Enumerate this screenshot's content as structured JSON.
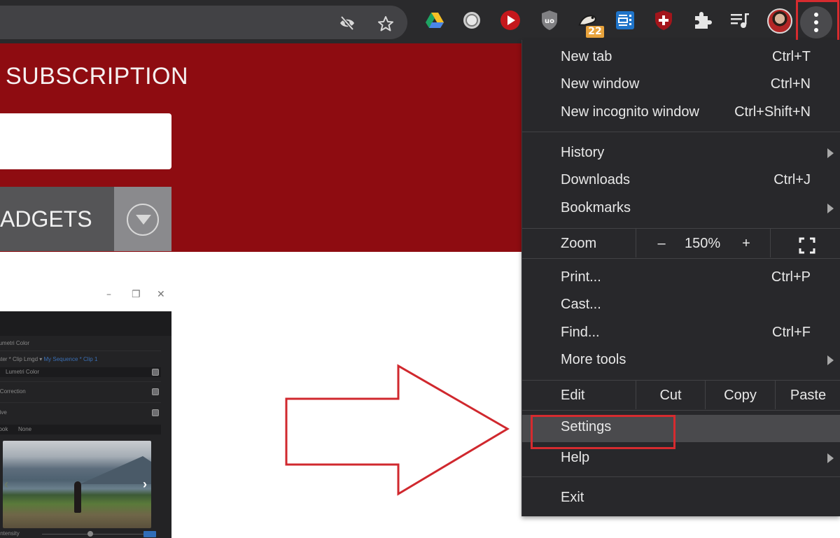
{
  "toolbar": {
    "omnibox": {
      "icons": [
        {
          "name": "eye-slash-icon",
          "label": "tracking-blocked"
        },
        {
          "name": "star-icon",
          "label": "bookmark"
        }
      ]
    },
    "extensions": [
      {
        "name": "google-drive-icon"
      },
      {
        "name": "screen-recorder-icon"
      },
      {
        "name": "youtube-play-icon"
      },
      {
        "name": "ublock-origin-icon"
      },
      {
        "name": "extension-creature-icon",
        "badge": "22"
      },
      {
        "name": "reader-mode-icon"
      },
      {
        "name": "security-shield-icon"
      },
      {
        "name": "extensions-puzzle-icon"
      },
      {
        "name": "media-queue-icon"
      }
    ],
    "profile": {
      "name": "avatar"
    },
    "menu_button": {
      "name": "kebab-menu-icon"
    }
  },
  "page": {
    "hero_title": "SUBSCRIPTION",
    "email_input_value": "",
    "gadgets_label": "ADGETS",
    "brand_color": "#8e0c11"
  },
  "embedded_screenshot": {
    "window_buttons": [
      "–",
      "❐",
      "✕"
    ],
    "panel_title": "Lumetri Color",
    "clip_path": "Master * Clip Lmgd",
    "clip_link": "My Sequence * Clip 1",
    "preset": "Lumetri Color",
    "rows": [
      "Basic Correction",
      "Creative"
    ],
    "look_label": "Look",
    "look_value": "None",
    "intensity_label": "Intensity"
  },
  "menu": {
    "groups": [
      [
        {
          "label": "New tab",
          "shortcut": "Ctrl+T"
        },
        {
          "label": "New window",
          "shortcut": "Ctrl+N"
        },
        {
          "label": "New incognito window",
          "shortcut": "Ctrl+Shift+N"
        }
      ],
      [
        {
          "label": "History",
          "shortcut": "",
          "submenu": true
        },
        {
          "label": "Downloads",
          "shortcut": "Ctrl+J"
        },
        {
          "label": "Bookmarks",
          "shortcut": "",
          "submenu": true
        }
      ]
    ],
    "zoom": {
      "label": "Zoom",
      "minus": "–",
      "value": "150%",
      "plus": "+"
    },
    "tools": [
      {
        "label": "Print...",
        "shortcut": "Ctrl+P"
      },
      {
        "label": "Cast...",
        "shortcut": ""
      },
      {
        "label": "Find...",
        "shortcut": "Ctrl+F"
      },
      {
        "label": "More tools",
        "shortcut": "",
        "submenu": true
      }
    ],
    "edit": {
      "label": "Edit",
      "cut": "Cut",
      "copy": "Copy",
      "paste": "Paste"
    },
    "settings": {
      "label": "Settings",
      "highlighted": true
    },
    "help": {
      "label": "Help",
      "submenu": true
    },
    "exit": {
      "label": "Exit"
    }
  },
  "annotations": {
    "highlight_color": "#d62b2f",
    "arrow_points_to": "Settings"
  }
}
